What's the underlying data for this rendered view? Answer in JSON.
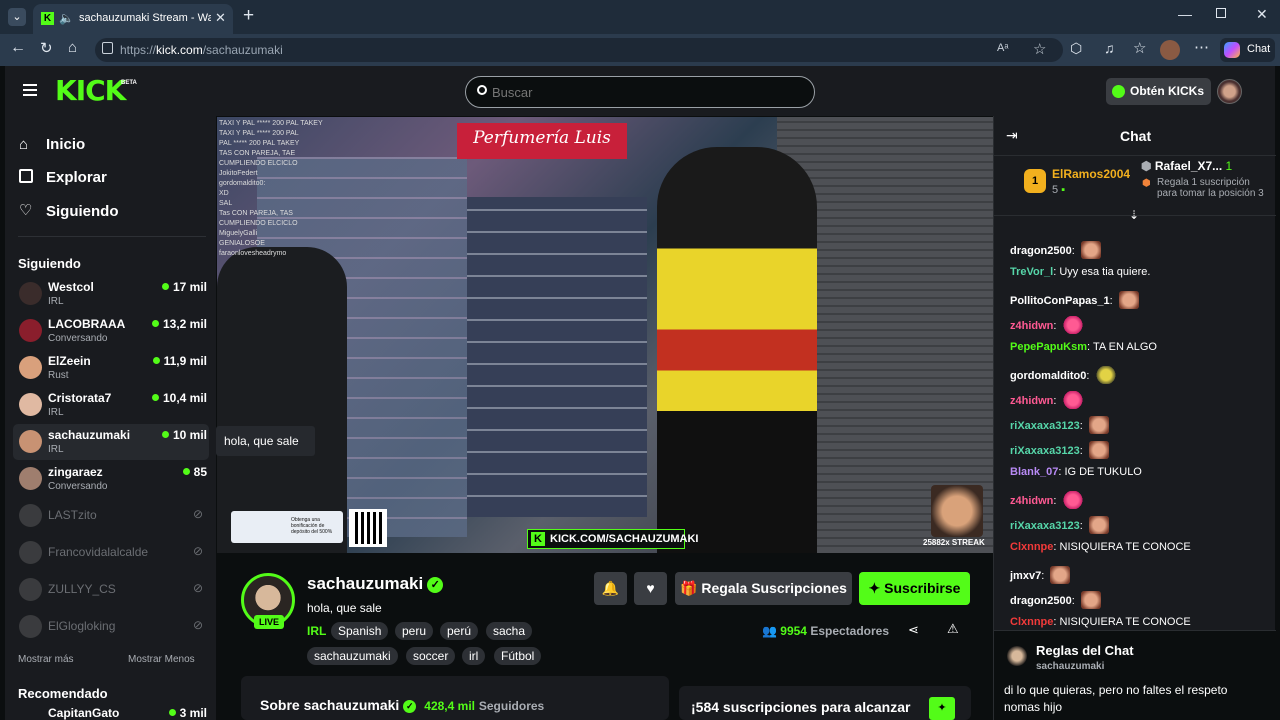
{
  "browser": {
    "tab_title": "sachauzumaki Stream - Watch",
    "url_prefix": "https://",
    "url_host": "kick.com",
    "url_path": "/sachauzumaki",
    "copilot_label": "Chat"
  },
  "header": {
    "logo": "KICK",
    "logo_beta": "BETA",
    "search_placeholder": "Buscar",
    "get_kicks": "Obtén KICKs"
  },
  "sidebar": {
    "nav": [
      {
        "label": "Inicio"
      },
      {
        "label": "Explorar"
      },
      {
        "label": "Siguiendo"
      }
    ],
    "following_heading": "Siguiendo",
    "following": [
      {
        "name": "Westcol",
        "category": "IRL",
        "viewers": "17 mil",
        "live": true,
        "avatar_color": "#3a2c2b"
      },
      {
        "name": "LACOBRAAA",
        "category": "Conversando",
        "viewers": "13,2 mil",
        "live": true,
        "avatar_color": "#8a1e2c"
      },
      {
        "name": "ElZeein",
        "category": "Rust",
        "viewers": "11,9 mil",
        "live": true,
        "avatar_color": "#d9a07c"
      },
      {
        "name": "Cristorata7",
        "category": "IRL",
        "viewers": "10,4 mil",
        "live": true,
        "avatar_color": "#e0b9a2"
      },
      {
        "name": "sachauzumaki",
        "category": "IRL",
        "viewers": "10 mil",
        "live": true,
        "avatar_color": "#c89273"
      },
      {
        "name": "zingaraez",
        "category": "Conversando",
        "viewers": "85",
        "live": true,
        "avatar_color": "#9f7e6e"
      },
      {
        "name": "LASTzito",
        "live": false,
        "avatar_color": "#777"
      },
      {
        "name": "Francovidalalcalde",
        "live": false,
        "avatar_color": "#777"
      },
      {
        "name": "ZULLYY_CS",
        "live": false,
        "avatar_color": "#777"
      },
      {
        "name": "ElGlogloking",
        "live": false,
        "avatar_color": "#777"
      }
    ],
    "show_more": "Mostrar más",
    "show_less": "Mostrar Menos",
    "recommended_heading": "Recomendado",
    "recommended": [
      {
        "name": "CapitanGato",
        "viewers": "3 mil"
      }
    ],
    "tooltip": "hola, que sale"
  },
  "video": {
    "shop_sign": "Perfumería Luis",
    "overlay_chat": [
      "TAXI Y PAL ***** 200 PAL TAKEY",
      "TAXI Y PAL ***** 200 PAL",
      "PAL ***** 200 PAL TAKEY",
      "TAS CON PAREJA, TAE",
      "CUMPLIENDO ELCICLO",
      "JokitoFedert",
      "gordomaldito0:",
      "XD",
      "SAL",
      "Tas CON PAREJA, TAS",
      "CUMPLIENDO ELCICLO",
      "MiguelyGalli",
      "GENIALOSOE",
      "faraonlovesheadrymo"
    ],
    "ad_text": "Obtenga una bonificación de depósito del 500%",
    "kick_banner": "KICK.COM/SACHAUZUMAKI",
    "streak": "25882x STREAK"
  },
  "channel": {
    "name": "sachauzumaki",
    "live_badge": "LIVE",
    "stream_title": "hola, que sale",
    "category": "IRL",
    "tags": [
      "Spanish",
      "peru",
      "perú",
      "sacha",
      "sachauzumaki",
      "soccer",
      "irl",
      "Fútbol"
    ],
    "gift_subs": "Regala Suscripciones",
    "subscribe": "Suscribirse",
    "viewers_count": "9954",
    "viewers_label": "Espectadores",
    "about_prefix": "Sobre sachauzumaki",
    "followers_count": "428,4 mil",
    "followers_label": "Seguidores",
    "subs_goal": "¡584 suscripciones para alcanzar"
  },
  "chat": {
    "title": "Chat",
    "leader1": {
      "name": "ElRamos2004",
      "rank": "1",
      "count": "5"
    },
    "leader2": {
      "name": "Rafael_X7...",
      "count": "1"
    },
    "leader3_text": "Regala 1 suscripción para tomar la posición 3",
    "messages": [
      {
        "user": "dragon2500",
        "text": "",
        "color": "#ffffff",
        "emote": "face"
      },
      {
        "user": "TreVor_l",
        "text": "Uyy esa tia quiere.",
        "color": "#56d6a9",
        "emote": ""
      },
      {
        "user": "PollitoConPapas_1",
        "text": "",
        "color": "#ffffff",
        "emote": "face"
      },
      {
        "user": "z4hidwn",
        "text": "",
        "color": "#ff5a93",
        "emote": "pink"
      },
      {
        "user": "PepePapuKsm",
        "text": "TA EN ALGO",
        "color": "#53fc18",
        "emote": ""
      },
      {
        "user": "gordomaldito0",
        "text": "",
        "color": "#ffffff",
        "emote": "yel"
      },
      {
        "user": "z4hidwn",
        "text": "",
        "color": "#ff5a93",
        "emote": "pink"
      },
      {
        "user": "riXaxaxa3123",
        "text": "",
        "color": "#56d6a9",
        "emote": "face"
      },
      {
        "user": "riXaxaxa3123",
        "text": "",
        "color": "#56d6a9",
        "emote": "face"
      },
      {
        "user": "Blank_07",
        "text": "IG DE TUKULO",
        "color": "#b88af5",
        "emote": ""
      },
      {
        "user": "z4hidwn",
        "text": "",
        "color": "#ff5a93",
        "emote": "pink"
      },
      {
        "user": "riXaxaxa3123",
        "text": "",
        "color": "#56d6a9",
        "emote": "face"
      },
      {
        "user": "Clxnnpe",
        "text": "NISIQUIERA TE CONOCE",
        "color": "#f23a3a",
        "emote": ""
      },
      {
        "user": "jmxv7",
        "text": "",
        "color": "#ffffff",
        "emote": "face"
      },
      {
        "user": "dragon2500",
        "text": "",
        "color": "#ffffff",
        "emote": "face"
      },
      {
        "user": "Clxnnpe",
        "text": "NISIQUIERA TE CONOCE",
        "color": "#f23a3a",
        "emote": ""
      }
    ],
    "rules_title": "Reglas del Chat",
    "rules_owner": "sachauzumaki",
    "rules_text_1": "di lo que quieras, pero no faltes el respeto",
    "rules_text_2": "nomas hijo"
  },
  "colors": {
    "accent": "#53fc18",
    "background": "#0b0e0f",
    "panel": "#191b1f"
  }
}
